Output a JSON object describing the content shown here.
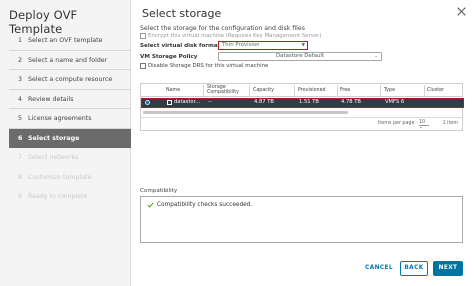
{
  "sidebar": {
    "title": "Deploy OVF Template",
    "steps": [
      {
        "num": "1",
        "label": "Select an OVF template"
      },
      {
        "num": "2",
        "label": "Select a name and folder"
      },
      {
        "num": "3",
        "label": "Select a compute resource"
      },
      {
        "num": "4",
        "label": "Review details"
      },
      {
        "num": "5",
        "label": "License agreements"
      },
      {
        "num": "6",
        "label": "Select storage"
      },
      {
        "num": "7",
        "label": "Select networks"
      },
      {
        "num": "8",
        "label": "Customize template"
      },
      {
        "num": "9",
        "label": "Ready to complete"
      }
    ]
  },
  "main": {
    "title": "Select storage",
    "subtitle": "Select the storage for the configuration and disk files",
    "encrypt_label": "Encrypt this virtual machine (Requires Key Management Server)",
    "disk_format_label": "Select virtual disk format",
    "disk_format_value": "Thin Provision",
    "policy_label": "VM Storage Policy",
    "policy_value": "Datastore Default",
    "drs_label": "Disable Storage DRS for this virtual machine"
  },
  "table": {
    "headers": {
      "name": "Name",
      "storage_compat_1": "Storage",
      "storage_compat_2": "Compatibility",
      "capacity": "Capacity",
      "provisioned": "Provisioned",
      "free": "Free",
      "type": "Type",
      "cluster": "Cluster"
    },
    "rows": [
      {
        "name": "datastor...",
        "compat": "--",
        "capacity": "4.87 TB",
        "provisioned": "1.51 TB",
        "free": "4.78 TB",
        "type": "VMFS 6",
        "cluster": ""
      }
    ],
    "items_per_page_label": "Items per page",
    "items_per_page_value": "10",
    "item_count": "1 item"
  },
  "compatibility": {
    "label": "Compatibility",
    "message": "Compatibility checks succeeded."
  },
  "buttons": {
    "cancel": "CANCEL",
    "back": "BACK",
    "next": "NEXT"
  },
  "colors": {
    "accent": "#0072a3",
    "highlight_border": "#c1121f",
    "selected_row": "#333c45",
    "current_step": "#6b6b6b",
    "success": "#5aa220"
  }
}
